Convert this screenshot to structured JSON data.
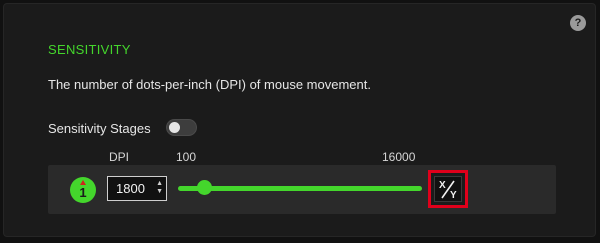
{
  "help": {
    "glyph": "?"
  },
  "section": {
    "title": "SENSITIVITY",
    "description": "The number of dots-per-inch (DPI) of mouse movement."
  },
  "stages": {
    "label": "Sensitivity Stages",
    "enabled": false
  },
  "columns": {
    "dpi_header": "DPI",
    "min_label": "100",
    "max_label": "16000"
  },
  "stage_row": {
    "stage_number": "1",
    "dpi_value": "1800",
    "slider": {
      "min": 100,
      "max": 16000,
      "value": 1800
    },
    "xy_button": {
      "x": "X",
      "y": "Y"
    }
  },
  "colors": {
    "accent": "#44d62c",
    "highlight": "#e0001b",
    "background": "#1b1b1b"
  }
}
